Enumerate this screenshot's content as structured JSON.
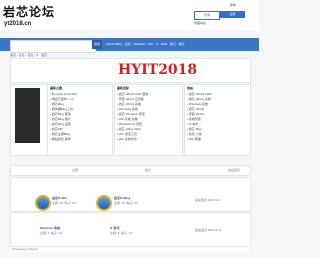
{
  "header": {
    "logo": "岩芯论坛",
    "logo_sub": "yt2018.cn",
    "login_label": "登录",
    "register_label": "注册",
    "user_link": "繁体",
    "menu": "收藏本站"
  },
  "nav": {
    "search_placeholder": "",
    "search_button": "搜索",
    "links": "Discuz·Blog · 论坛 · Windows · Win · IT · EXE · 热门 · 排行"
  },
  "breadcrumb": "首页 › 论坛 › 论坛 › IT · 岩芯",
  "banner": {
    "title": "HYIT2018"
  },
  "panels": [
    {
      "title": "最新主题",
      "items": [
        "• ${.ngrok.com}:4(0)",
        "• 域名已发布~~cp",
        "• 岩芯Blog",
        "• 服务器Blog工具",
        "• 岩芯Blog 使用",
        "• 岩芯Blog 统计",
        "• 岩芯Blog 设置",
        "• 岩芯ZIP",
        "• 岩芯主题Blog",
        "• 网站回复 发布"
      ]
    },
    {
      "title": "最新回复",
      "items": [
        "• 岩芯 Win10 2022 更新",
        "• 安装 Win11 正式版",
        "• 岩芯 Win10 系统",
        "• Windows 系统",
        "• 岩芯 Windows 激活",
        "• Win 系统 镜像",
        "• Windows 10 安装",
        "• 岩芯 Office 2021",
        "• Win 激活工具",
        "• Win 系统优化"
      ]
    },
    {
      "title": "热帖",
      "items": [
        "• 岩芯 Win10 2022",
        "• 岩芯 Win11 系统",
        "• Windows 系统",
        "• 岩芯 Win10",
        "• 安装 Win11",
        "• 系统安装",
        "• IT 技术",
        "• 岩芯 Blog",
        "• 论坛 公告",
        "• Win 教程"
      ]
    }
  ],
  "category": {
    "col1": "主题",
    "col2": "帖子",
    "col3": "最后发表"
  },
  "forums": [
    {
      "name": "岩芯IT-Win",
      "meta": "主题: 29, 帖子: 84",
      "right": "最后发表 2022-5-8"
    },
    {
      "name": "岩芯IT-Blog",
      "meta": "主题: 19, 帖子: 63",
      "right": "最后发表 2022-4-15"
    },
    {
      "name": "Windows 系统",
      "meta": "主题: 6, 帖子: 12",
      "right": "最后发表 2022-3-2"
    },
    {
      "name": "IT 资讯",
      "meta": "主题: 8, 帖子: 21",
      "right": "最后发表 2022-2-10"
    }
  ],
  "footer": "Powered by Discuz!"
}
